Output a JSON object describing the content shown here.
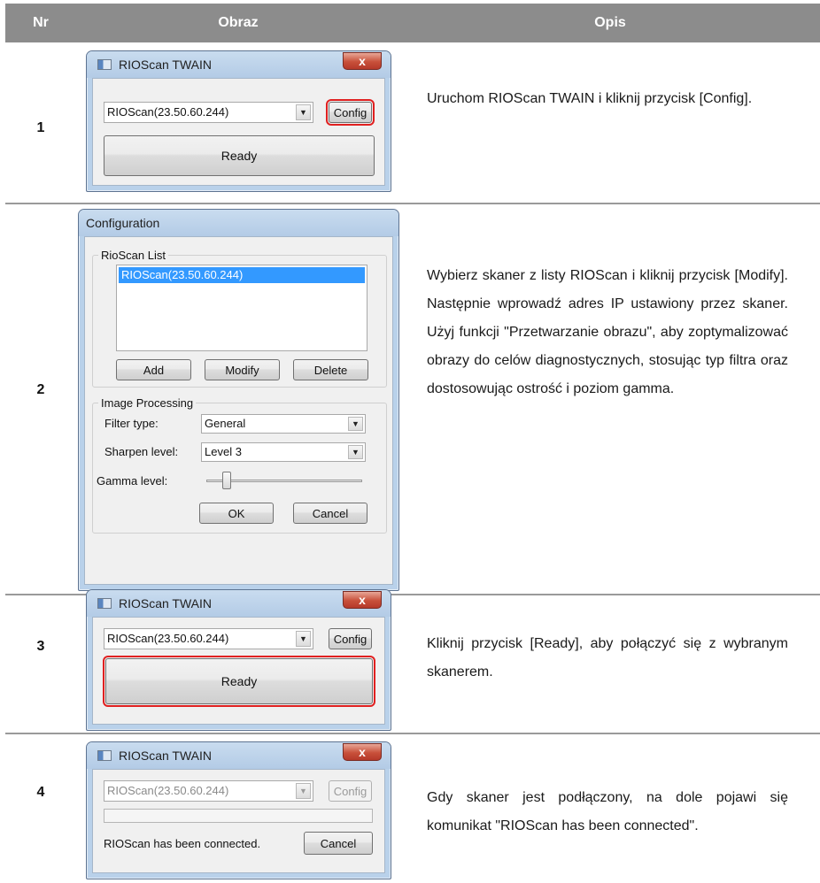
{
  "header": {
    "nr": "Nr",
    "image": "Obraz",
    "description": "Opis"
  },
  "rows": [
    {
      "nr": "1",
      "description": "Uruchom RIOScan TWAIN i kliknij przycisk [Config].",
      "dialog": {
        "title": "RIOScan TWAIN",
        "close": "x",
        "scanner": "RIOScan(23.50.60.244)",
        "config": "Config",
        "ready": "Ready"
      }
    },
    {
      "nr": "2",
      "description": "Wybierz skaner z listy RIOScan i kliknij przycisk [Modify]. Następnie wprowadź adres IP ustawiony przez skaner. Użyj funkcji \"Przetwarzanie obrazu\", aby zoptymalizować obrazy do celów diagnostycznych, stosując typ filtra oraz dostosowując ostrość i poziom gamma.",
      "dialog": {
        "title": "Configuration",
        "list_group": "RioScan List",
        "list_items": [
          "RIOScan(23.50.60.244)"
        ],
        "add": "Add",
        "modify": "Modify",
        "delete": "Delete",
        "image_group": "Image Processing",
        "filter_label": "Filter type:",
        "filter_value": "General",
        "sharpen_label": "Sharpen level:",
        "sharpen_value": "Level 3",
        "gamma_label": "Gamma level:",
        "ok": "OK",
        "cancel": "Cancel"
      }
    },
    {
      "nr": "3",
      "description": "Kliknij przycisk [Ready], aby połączyć się z wybranym skanerem.",
      "dialog": {
        "title": "RIOScan TWAIN",
        "close": "x",
        "scanner": "RIOScan(23.50.60.244)",
        "config": "Config",
        "ready": "Ready"
      }
    },
    {
      "nr": "4",
      "description": "Gdy skaner jest podłączony, na dole pojawi się komunikat \"RIOScan has been connected\".",
      "dialog": {
        "title": "RIOScan TWAIN",
        "close": "x",
        "scanner": "RIOScan(23.50.60.244)",
        "config": "Config",
        "status": "RIOScan has been connected.",
        "cancel": "Cancel"
      }
    }
  ]
}
